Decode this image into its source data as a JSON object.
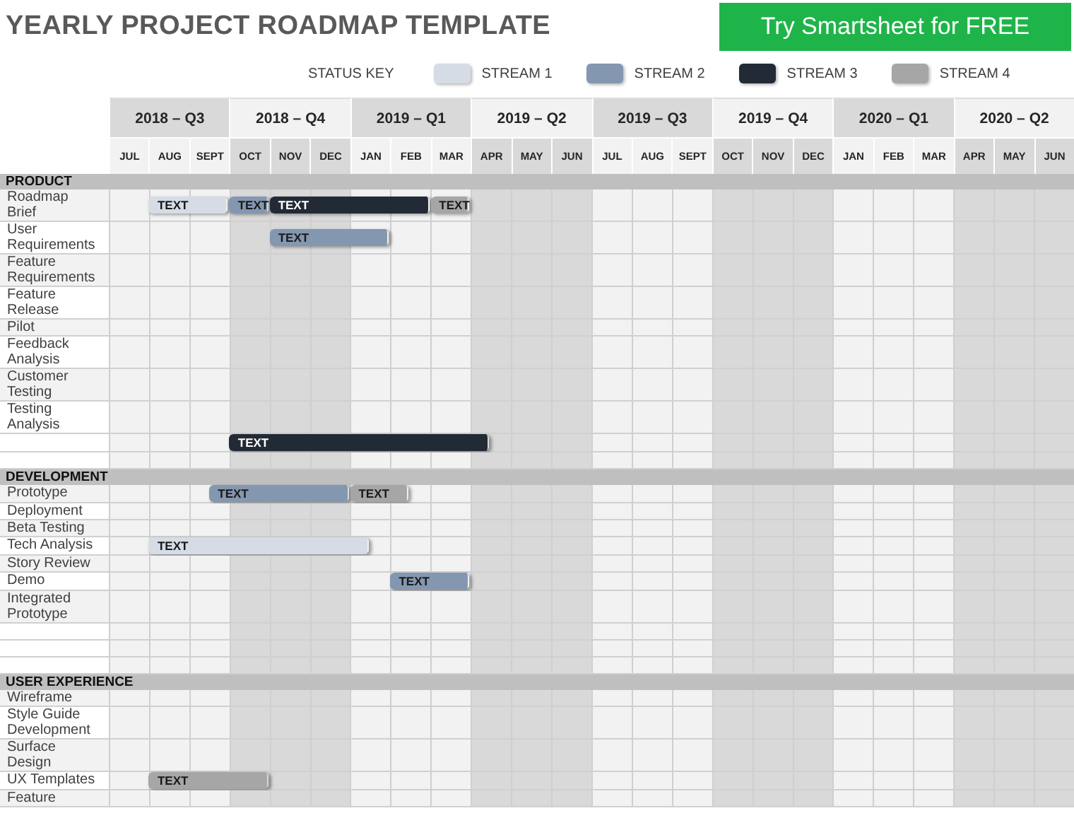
{
  "title": "YEARLY PROJECT ROADMAP TEMPLATE",
  "cta_button": "Try Smartsheet for FREE",
  "status_key": {
    "label": "STATUS KEY",
    "streams": [
      {
        "label": "STREAM 1",
        "color": "#d6dce5"
      },
      {
        "label": "STREAM 2",
        "color": "#8497b0"
      },
      {
        "label": "STREAM 3",
        "color": "#222a35"
      },
      {
        "label": "STREAM 4",
        "color": "#a6a6a6"
      }
    ]
  },
  "quarters": [
    {
      "label": "2018 – Q3",
      "months": [
        "JUL",
        "AUG",
        "SEPT"
      ]
    },
    {
      "label": "2018 – Q4",
      "months": [
        "OCT",
        "NOV",
        "DEC"
      ]
    },
    {
      "label": "2019 – Q1",
      "months": [
        "JAN",
        "FEB",
        "MAR"
      ]
    },
    {
      "label": "2019 – Q2",
      "months": [
        "APR",
        "MAY",
        "JUN"
      ]
    },
    {
      "label": "2019 – Q3",
      "months": [
        "JUL",
        "AUG",
        "SEPT"
      ]
    },
    {
      "label": "2019 – Q4",
      "months": [
        "OCT",
        "NOV",
        "DEC"
      ]
    },
    {
      "label": "2020 – Q1",
      "months": [
        "JAN",
        "FEB",
        "MAR"
      ]
    },
    {
      "label": "2020 – Q2",
      "months": [
        "APR",
        "MAY",
        "JUN"
      ]
    }
  ],
  "sections": [
    {
      "title": "PRODUCT",
      "rows": [
        {
          "label": "Roadmap Brief",
          "segments": [
            {
              "kind": "gap",
              "span": [
                {
                  "kind": "month"
                }
              ]
            },
            {
              "kind": "bar",
              "text": "TEXT",
              "color": "#d6dce5",
              "span": [
                {
                  "kind": "month"
                },
                {
                  "kind": "month"
                }
              ]
            },
            {
              "kind": "bar",
              "text": "TEXT",
              "color": "#8497b0",
              "span": [
                {
                  "kind": "month"
                }
              ]
            },
            {
              "kind": "bar",
              "text": "TEXT",
              "color": "#222a35",
              "span": [
                {
                  "kind": "month"
                },
                {
                  "kind": "month"
                },
                {
                  "kind": "month"
                },
                {
                  "kind": "month"
                }
              ]
            },
            {
              "kind": "bar",
              "text": "TEXT",
              "color": "#a6a6a6",
              "span": [
                {
                  "kind": "month"
                }
              ]
            }
          ]
        },
        {
          "label": "User Requirements",
          "segments": [
            {
              "kind": "gap",
              "span": [
                {
                  "kind": "month"
                },
                {
                  "kind": "month"
                },
                {
                  "kind": "month"
                },
                {
                  "kind": "month"
                }
              ]
            },
            {
              "kind": "bar",
              "text": "TEXT",
              "color": "#8497b0",
              "span": [
                {
                  "kind": "month"
                },
                {
                  "kind": "month"
                },
                {
                  "kind": "month"
                }
              ]
            }
          ]
        },
        {
          "label": "Feature Requirements"
        },
        {
          "label": "Feature Release"
        },
        {
          "label": "Pilot"
        },
        {
          "label": "Feedback Analysis"
        },
        {
          "label": "Customer Testing"
        },
        {
          "label": "Testing Analysis"
        },
        {
          "segments": [
            {
              "kind": "gap",
              "span": [
                {
                  "kind": "month"
                },
                {
                  "kind": "month"
                },
                {
                  "kind": "month"
                }
              ]
            },
            {
              "kind": "bar",
              "text": "TEXT",
              "color": "#222a35",
              "span": [
                {
                  "kind": "month"
                },
                {
                  "kind": "month"
                },
                {
                  "kind": "month"
                },
                {
                  "kind": "month"
                },
                {
                  "kind": "month"
                },
                {
                  "kind": "month"
                },
                {
                  "kind": "half"
                }
              ]
            }
          ]
        },
        {}
      ]
    },
    {
      "title": "DEVELOPMENT",
      "rows": [
        {
          "label": "Prototype",
          "segments": [
            {
              "kind": "gap",
              "span": [
                {
                  "kind": "month"
                },
                {
                  "kind": "month"
                },
                {
                  "kind": "half"
                }
              ]
            },
            {
              "kind": "bar",
              "text": "TEXT",
              "color": "#8497b0",
              "span": [
                {
                  "kind": "month"
                },
                {
                  "kind": "month"
                },
                {
                  "kind": "month"
                },
                {
                  "kind": "half"
                }
              ]
            },
            {
              "kind": "bar",
              "text": "TEXT",
              "color": "#a6a6a6",
              "span": [
                {
                  "kind": "month"
                },
                {
                  "kind": "half"
                }
              ]
            }
          ]
        },
        {
          "label": "Deployment"
        },
        {
          "label": "Beta Testing"
        },
        {
          "label": "Tech Analysis",
          "segments": [
            {
              "kind": "gap",
              "span": [
                {
                  "kind": "month"
                }
              ]
            },
            {
              "kind": "bar",
              "text": "TEXT",
              "color": "#d6dce5",
              "span": [
                {
                  "kind": "month"
                },
                {
                  "kind": "month"
                },
                {
                  "kind": "month"
                },
                {
                  "kind": "month"
                },
                {
                  "kind": "month"
                },
                {
                  "kind": "half"
                }
              ]
            }
          ]
        },
        {
          "label": "Story Review"
        },
        {
          "label": "Demo",
          "segments": [
            {
              "kind": "gap",
              "span": [
                {
                  "kind": "month"
                },
                {
                  "kind": "month"
                },
                {
                  "kind": "month"
                },
                {
                  "kind": "month"
                },
                {
                  "kind": "month"
                },
                {
                  "kind": "month"
                },
                {
                  "kind": "month"
                }
              ]
            },
            {
              "kind": "bar",
              "text": "TEXT",
              "color": "#8497b0",
              "span": [
                {
                  "kind": "month"
                },
                {
                  "kind": "month"
                }
              ]
            }
          ]
        },
        {
          "label": "Integrated Prototype"
        },
        {},
        {},
        {}
      ]
    },
    {
      "title": "USER EXPERIENCE",
      "rows": [
        {
          "label": "Wireframe"
        },
        {
          "label": "Style Guide Development"
        },
        {
          "label": "Surface Design"
        },
        {
          "label": "UX Templates",
          "segments": [
            {
              "kind": "gap",
              "span": [
                {
                  "kind": "month"
                }
              ]
            },
            {
              "kind": "bar",
              "text": "TEXT",
              "color": "#a6a6a6",
              "span": [
                {
                  "kind": "month"
                },
                {
                  "kind": "month"
                },
                {
                  "kind": "month"
                }
              ]
            }
          ]
        },
        {
          "label": "Feature"
        }
      ]
    }
  ]
}
